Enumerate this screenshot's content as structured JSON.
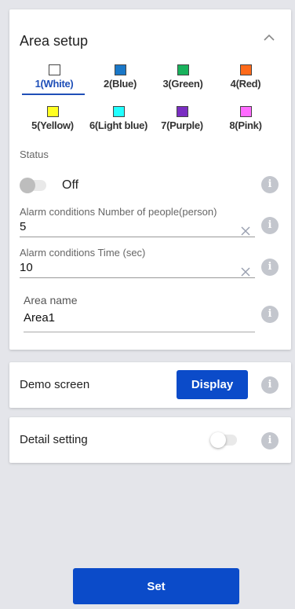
{
  "area_setup": {
    "title": "Area setup",
    "areas": [
      {
        "label": "1(White)",
        "color": "#ffffff",
        "active": true
      },
      {
        "label": "2(Blue)",
        "color": "#1a78c8",
        "active": false
      },
      {
        "label": "3(Green)",
        "color": "#19b25c",
        "active": false
      },
      {
        "label": "4(Red)",
        "color": "#ff6a1a",
        "active": false
      },
      {
        "label": "5(Yellow)",
        "color": "#ffff22",
        "active": false
      },
      {
        "label": "6(Light blue)",
        "color": "#22ffff",
        "active": false
      },
      {
        "label": "7(Purple)",
        "color": "#7a2ec2",
        "active": false
      },
      {
        "label": "8(Pink)",
        "color": "#ff6bff",
        "active": false
      }
    ],
    "status": {
      "label": "Status",
      "value": "Off"
    },
    "people": {
      "label": "Alarm conditions Number of  people(person)",
      "value": "5"
    },
    "time": {
      "label": "Alarm conditions Time (sec)",
      "value": "10"
    },
    "area_name": {
      "label": "Area name",
      "value": "Area1"
    }
  },
  "demo": {
    "label": "Demo screen",
    "button": "Display"
  },
  "detail": {
    "label": "Detail setting"
  },
  "set_button": "Set",
  "colors": {
    "accent": "#0b4bc9",
    "tab_active": "#1f4fb8",
    "info": "#c3c6cd"
  }
}
